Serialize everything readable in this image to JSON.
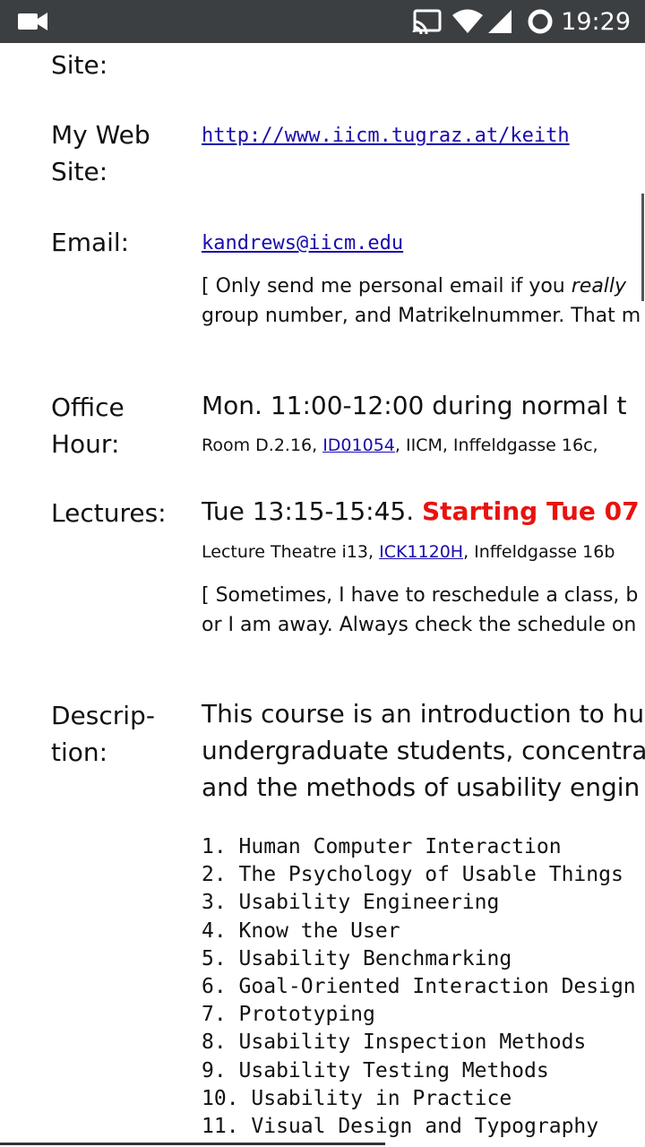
{
  "status_bar": {
    "time": "19:29",
    "icons": [
      "video-camera-icon",
      "cast-icon",
      "wifi-icon",
      "signal-icon",
      "sync-ring-icon"
    ]
  },
  "labels": {
    "site_tail": "Site:",
    "web_site_1": "My Web",
    "web_site_2": "Site:",
    "email": "Email:",
    "office_1": "Office",
    "office_2": "Hour:",
    "lectures": "Lectures:",
    "desc_1": "Descrip-",
    "desc_2": "tion:"
  },
  "web": {
    "url": "http://www.iicm.tugraz.at/keith"
  },
  "email": {
    "address": "kandrews@iicm.edu",
    "note_1a": "[ Only send me personal email if you ",
    "note_1b": "really",
    "note_2": "group number, and Matrikelnummer. That m"
  },
  "office": {
    "time": "Mon. 11:00-12:00 during normal t",
    "room_a": "Room D.2.16, ",
    "room_link": "ID01054",
    "room_b": ", IICM, Inffeldgasse 16c, "
  },
  "lectures": {
    "time": "Tue 13:15-15:45. ",
    "start": "Starting Tue 07",
    "theatre_a": "Lecture Theatre i13, ",
    "theatre_link": "ICK1120H",
    "theatre_b": ", Inffeldgasse 16b",
    "note_1": "[ Sometimes, I have to reschedule a class, b",
    "note_2": "or I am away. Always check the schedule on"
  },
  "description": {
    "line_1": "This course is an introduction to hu",
    "line_2": "undergraduate students, concentra",
    "line_3": "and the methods of usability engin"
  },
  "topics": [
    "1. Human Computer Interaction",
    "2. The Psychology of Usable Things",
    "3. Usability Engineering",
    "4. Know the User",
    "5. Usability Benchmarking",
    "6. Goal-Oriented Interaction Design",
    "7. Prototyping",
    "8. Usability Inspection Methods",
    "9. Usability Testing Methods",
    "10. Usability in Practice",
    "11. Visual Design and Typography"
  ]
}
